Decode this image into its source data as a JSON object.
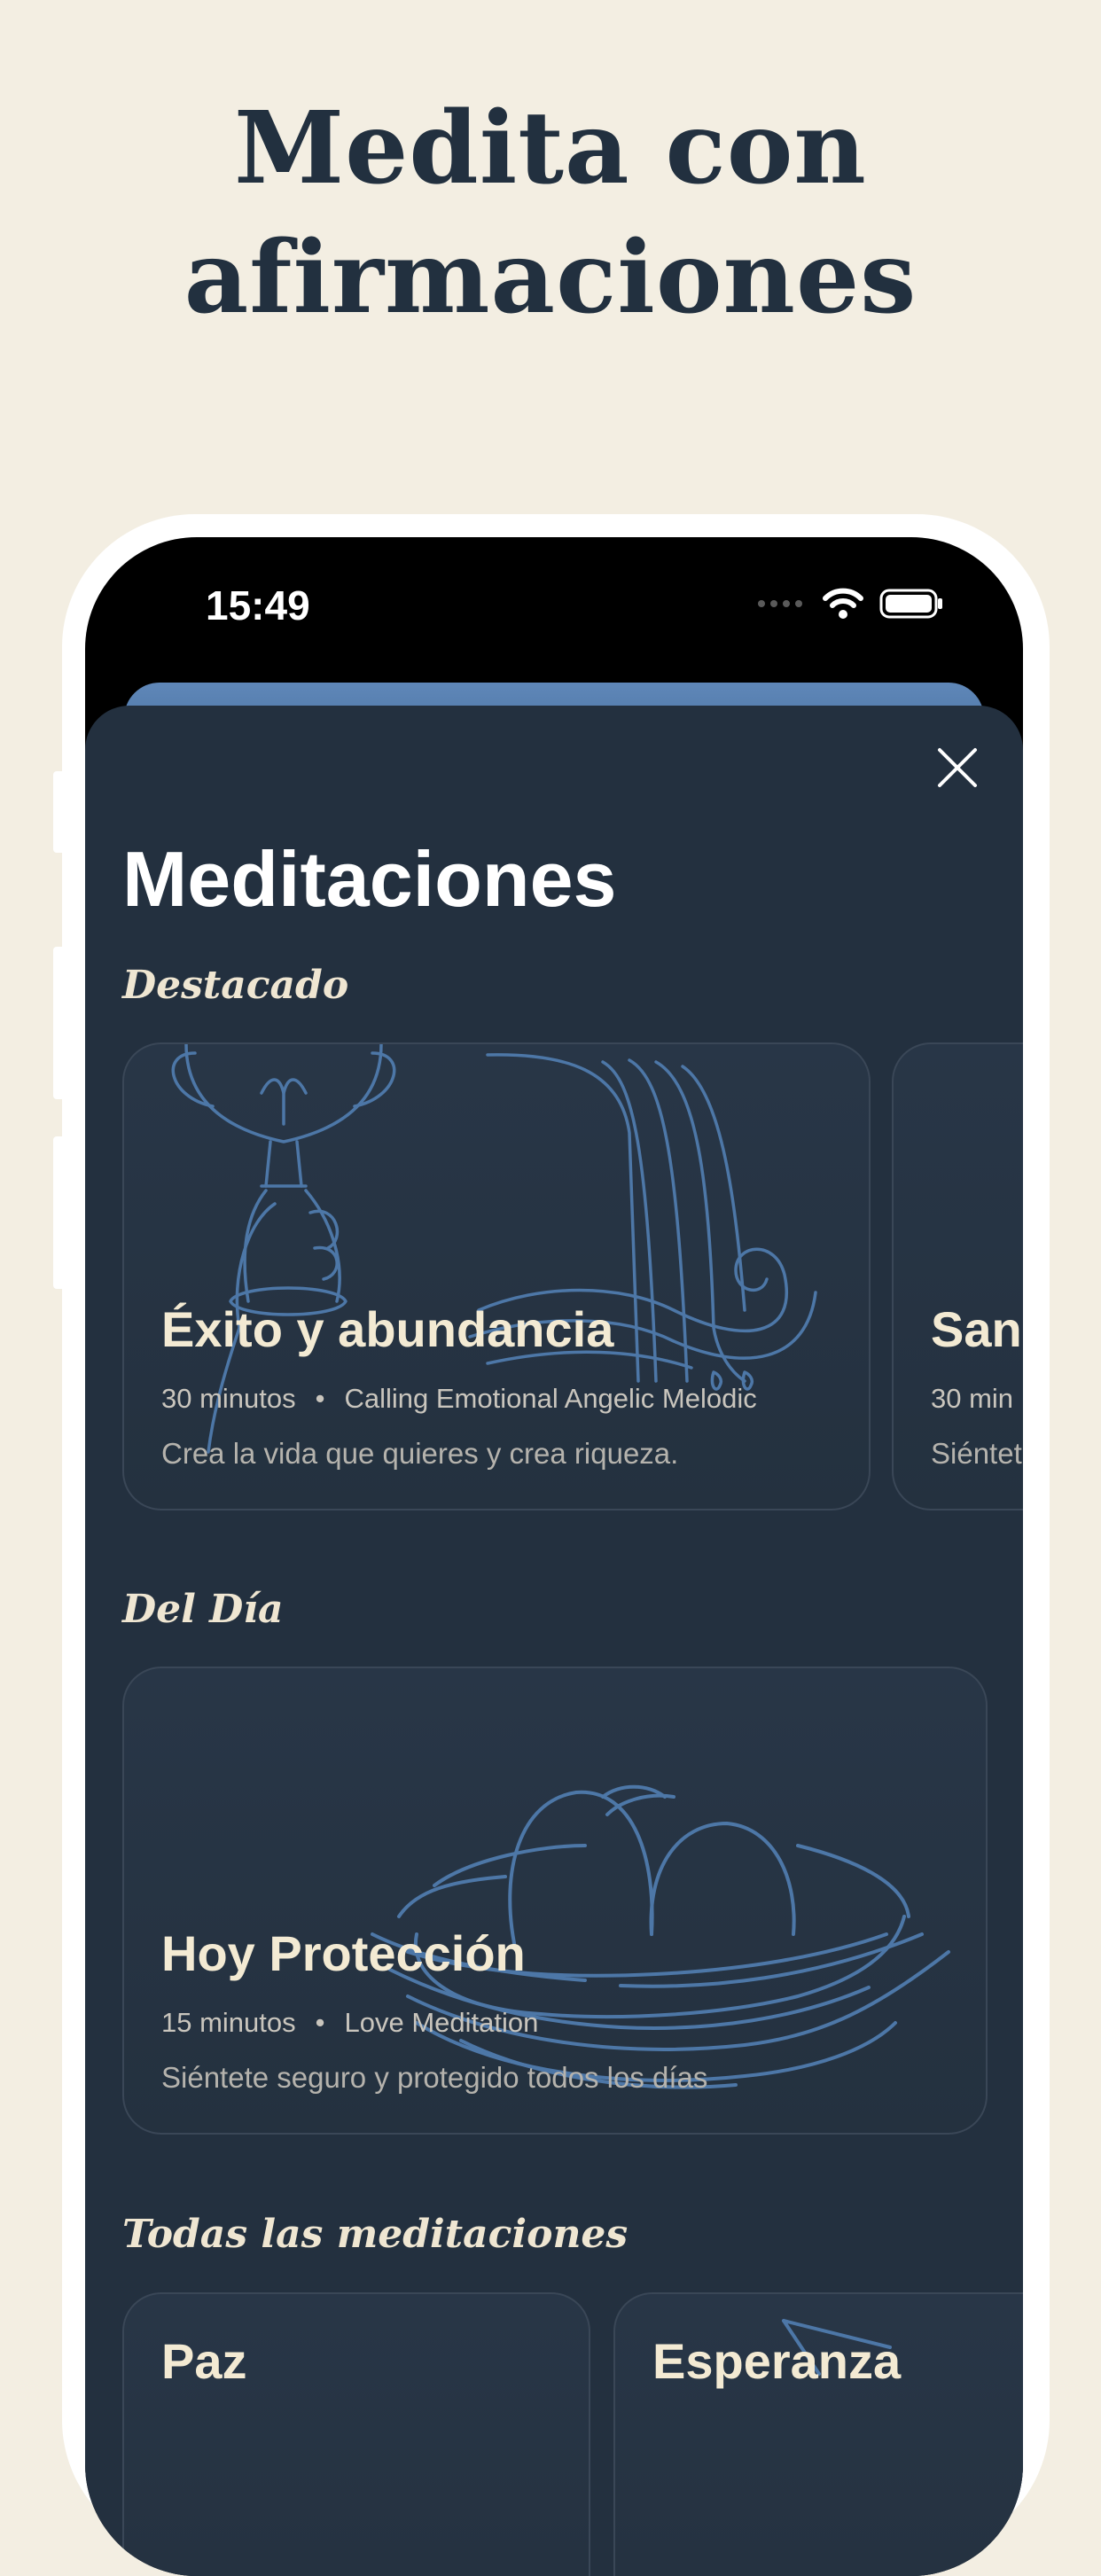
{
  "headline": {
    "line1": "Medita con",
    "line2": "afirmaciones"
  },
  "status_bar": {
    "time": "15:49",
    "icons": [
      "signal-dots-icon",
      "wifi-icon",
      "battery-icon"
    ]
  },
  "sheet": {
    "title": "Meditaciones",
    "close_icon": "close-icon",
    "sections": {
      "featured": {
        "label": "Destacado",
        "cards": [
          {
            "title": "Éxito y abundancia",
            "duration": "30 minutos",
            "artist": "Calling Emotional Angelic Melodic",
            "description": "Crea la vida que quieres y crea riqueza.",
            "illustration": "chalice-waterfall-icon"
          },
          {
            "title": "San",
            "duration": "30 min",
            "description": "Siéntet"
          }
        ]
      },
      "daily": {
        "label": "Del Día",
        "card": {
          "title": "Hoy Protección",
          "duration": "15 minutos",
          "artist": "Love Meditation",
          "description": "Siéntete seguro y protegido todos los días",
          "illustration": "nest-eggs-icon"
        }
      },
      "all": {
        "label": "Todas las meditaciones",
        "cards": [
          {
            "title": "Paz"
          },
          {
            "title": "Esperanza"
          }
        ]
      }
    }
  },
  "colors": {
    "background": "#f3eee2",
    "headline": "#22303f",
    "sheet": "#23303f",
    "card_title": "#f3ead3",
    "illustration_stroke": "#4d77a7"
  }
}
